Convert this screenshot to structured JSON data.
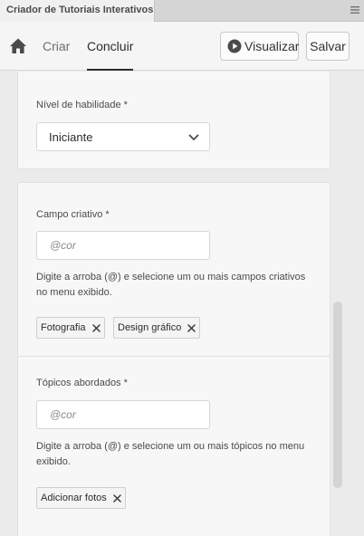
{
  "panel": {
    "title": "Criador de Tutoriais Interativos",
    "menu_icon": "hamburger-menu-icon"
  },
  "header": {
    "home_icon": "home-icon",
    "tabs": [
      {
        "label": "Criar",
        "active": false
      },
      {
        "label": "Concluir",
        "active": true
      }
    ],
    "preview_button": {
      "label": "Visualizar",
      "icon": "play-circle-icon"
    },
    "save_button": {
      "label": "Salvar"
    }
  },
  "form": {
    "skill_level": {
      "label": "Nível de habilidade *",
      "value": "Iniciante",
      "icon": "chevron-down-icon"
    },
    "creative_field": {
      "label": "Campo criativo *",
      "placeholder": "@cor",
      "help": "Digite a arroba (@) e selecione um ou mais campos criativos no menu exibido.",
      "tags": [
        "Fotografia",
        "Design gráfico"
      ]
    },
    "topics": {
      "label": "Tópicos abordados *",
      "placeholder": "@cor",
      "help": "Digite a arroba (@) e selecione um ou mais tópicos no menu exibido.",
      "tags": [
        "Adicionar fotos"
      ]
    }
  },
  "colors": {
    "background": "#ebebeb",
    "card": "#f7f7f7",
    "active_tab": "#2c2c2c",
    "inactive_tab": "#6e6e6e"
  }
}
